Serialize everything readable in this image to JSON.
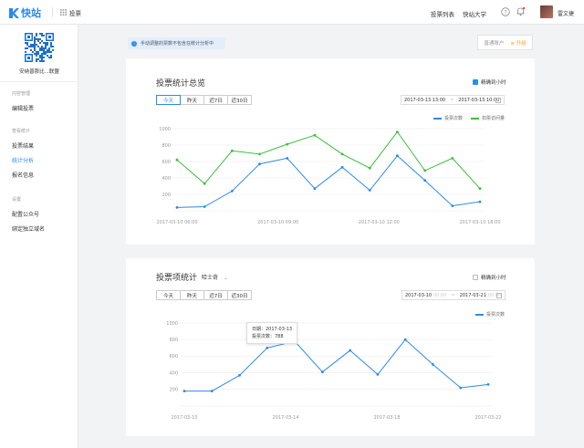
{
  "app": {
    "logo_text": "快站",
    "section": "投票"
  },
  "topbar": {
    "links": [
      "投票列表",
      "快站大学"
    ],
    "username": "雷文捷"
  },
  "sidebar": {
    "account_name": "安纳普那比...联盟",
    "groups": [
      {
        "title": "内容管理",
        "items": [
          "编辑投票"
        ]
      },
      {
        "title": "查看统计",
        "items": [
          "投票结果",
          "统计分析",
          "报名信息"
        ]
      },
      {
        "title": "设置",
        "items": [
          "配置公众号",
          "绑定独立域名"
        ]
      }
    ],
    "active_item": "统计分析"
  },
  "tip": {
    "text": "手动调整的票数不包含在统计分析中"
  },
  "plan": {
    "label": "普通账户",
    "upgrade": "≡ 升级"
  },
  "overview": {
    "title": "投票统计总览",
    "hourly_label": "精确到小时",
    "hourly_checked": true,
    "ranges": [
      "今天",
      "昨天",
      "近7日",
      "近30日"
    ],
    "active_range": 0,
    "date_from": "2017-03-13 13:00",
    "date_sep": "~",
    "date_to": "2017-03-13 10:00"
  },
  "item_stats": {
    "title": "投票项统计",
    "item_selected": "哈士奇",
    "hourly_label": "精确到小时",
    "hourly_checked": false,
    "ranges": [
      "今天",
      "昨天",
      "近7日",
      "近30日"
    ],
    "date_from": "2017-03-10",
    "date_from_suffix": "00:00",
    "date_sep": "~",
    "date_to": "2017-03-21",
    "date_to_suffix": "00:00"
  },
  "tooltip": {
    "date_label": "日期：2017-03-13",
    "votes_label": "投票次数：788"
  },
  "colors": {
    "accent": "#2b8be8",
    "green": "#3cbf3c",
    "warning": "#f7a32b"
  },
  "chart_data": [
    {
      "type": "line",
      "title": "投票统计总览",
      "x_tick_labels": [
        "2017-03-10 06:00",
        "2017-03-10 09:00",
        "2017-03-10 12:00",
        "2017-03-10 18:00"
      ],
      "y_tick_labels": [
        "1000",
        "800",
        "600",
        "400",
        "200"
      ],
      "ylim": [
        0,
        1000
      ],
      "grid": true,
      "legend": "top-right",
      "series": [
        {
          "name": "投票次数",
          "color": "#2b8be8",
          "values": [
            40,
            50,
            240,
            570,
            640,
            270,
            530,
            250,
            670,
            370,
            60,
            110
          ]
        },
        {
          "name": "扣票访问量",
          "color": "#3cbf3c",
          "values": [
            620,
            330,
            730,
            690,
            810,
            920,
            690,
            520,
            960,
            490,
            640,
            270
          ]
        }
      ]
    },
    {
      "type": "line",
      "title": "投票项统计",
      "x_tick_labels": [
        "2017-03-10",
        "2017-03-14",
        "2017-03-18",
        "2017-03-22"
      ],
      "y_tick_labels": [
        "1000",
        "800",
        "600",
        "400",
        "200"
      ],
      "ylim": [
        0,
        1000
      ],
      "grid": true,
      "legend": "top-right",
      "series": [
        {
          "name": "投票次数",
          "color": "#2b8be8",
          "values": [
            180,
            180,
            370,
            700,
            780,
            410,
            670,
            380,
            800,
            500,
            220,
            260
          ]
        }
      ]
    }
  ]
}
